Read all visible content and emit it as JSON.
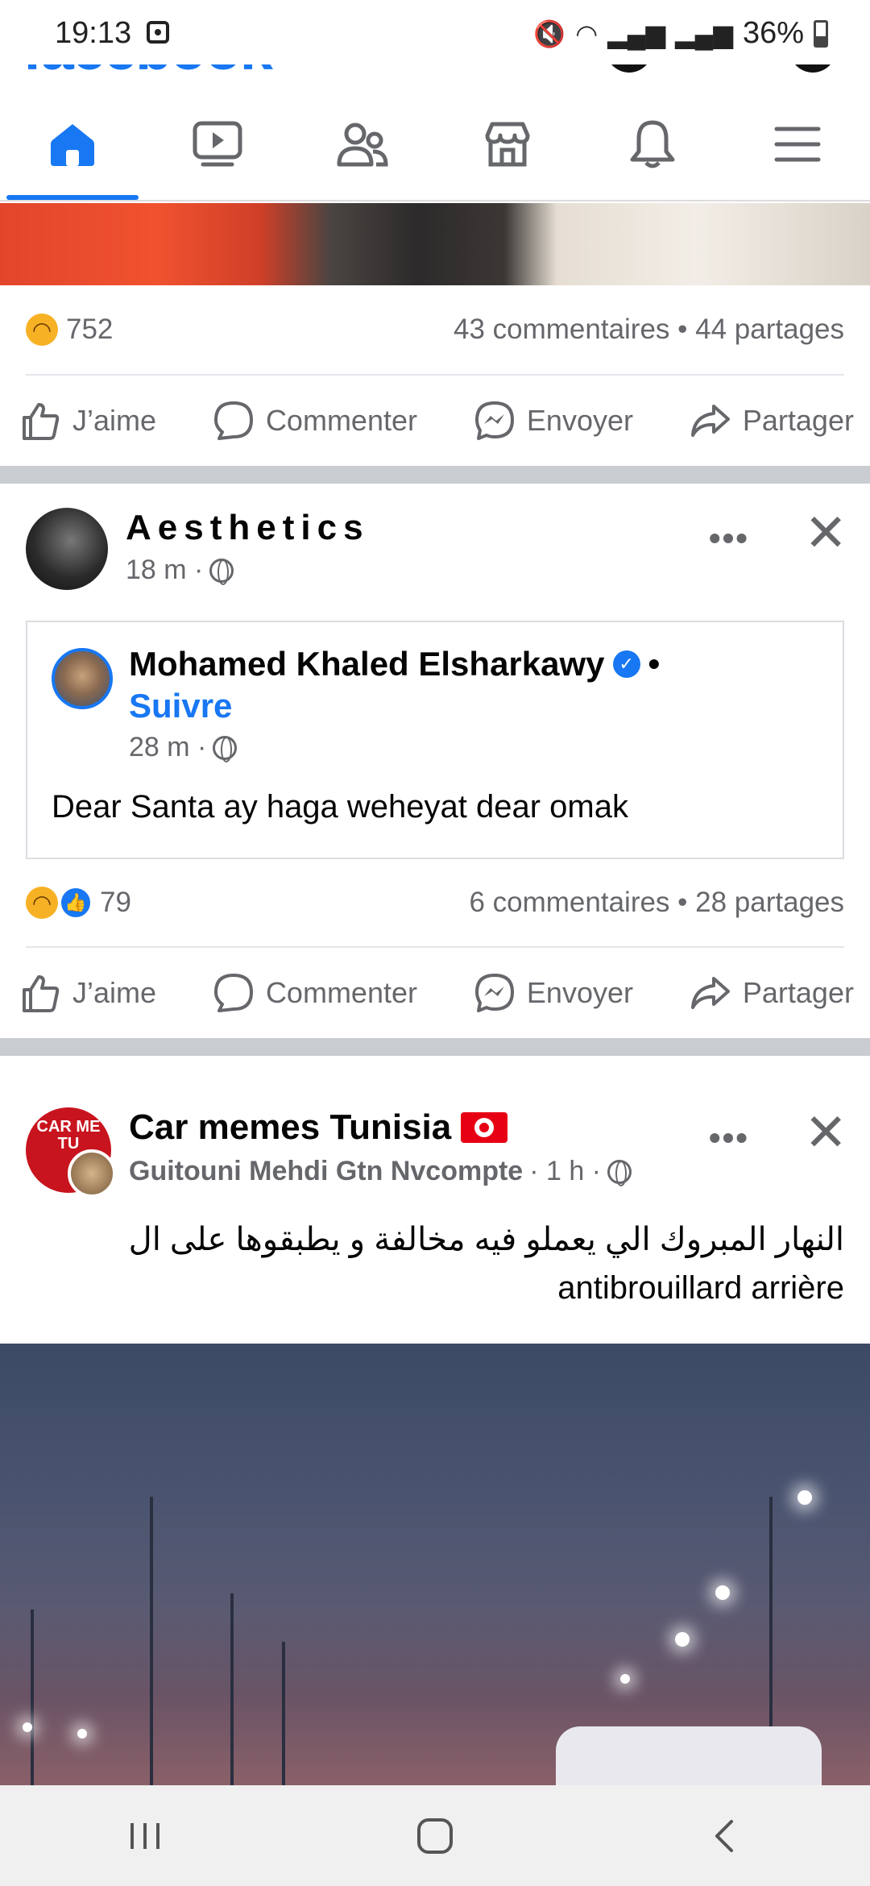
{
  "status_bar": {
    "time": "19:13",
    "battery": "36%"
  },
  "header": {
    "logo": "facebook"
  },
  "tabs": [
    {
      "name": "home",
      "active": true
    },
    {
      "name": "video",
      "active": false
    },
    {
      "name": "friends",
      "active": false
    },
    {
      "name": "marketplace",
      "active": false
    },
    {
      "name": "notifications",
      "active": false
    },
    {
      "name": "menu",
      "active": false
    }
  ],
  "post1": {
    "reaction_count": "752",
    "stats": "43 commentaires • 44 partages"
  },
  "actions": {
    "like": "J’aime",
    "comment": "Commenter",
    "send": "Envoyer",
    "share": "Partager"
  },
  "post2": {
    "author": "Aesthetics",
    "time": "18 m ·",
    "shared": {
      "author": "Mohamed Khaled Elsharkawy",
      "dot": "•",
      "follow": "Suivre",
      "time": "28 m ·",
      "text": "Dear Santa ay haga weheyat dear omak"
    },
    "reaction_count": "79",
    "stats": "6 commentaires • 28 partages"
  },
  "post3": {
    "page_name": "Car memes Tunisia",
    "avatar_text": "CAR ME TU",
    "poster": "Guitouni Mehdi Gtn Nvcompte",
    "time": "· 1 h ·",
    "text_line1": "النهار المبروك الي يعملو فيه مخالفة و يطبقوها على ال",
    "text_line2": "antibrouillard arrière"
  },
  "colors": {
    "brand": "#1877f2",
    "secondary_text": "#65676b",
    "separator": "#c9ccd1"
  }
}
